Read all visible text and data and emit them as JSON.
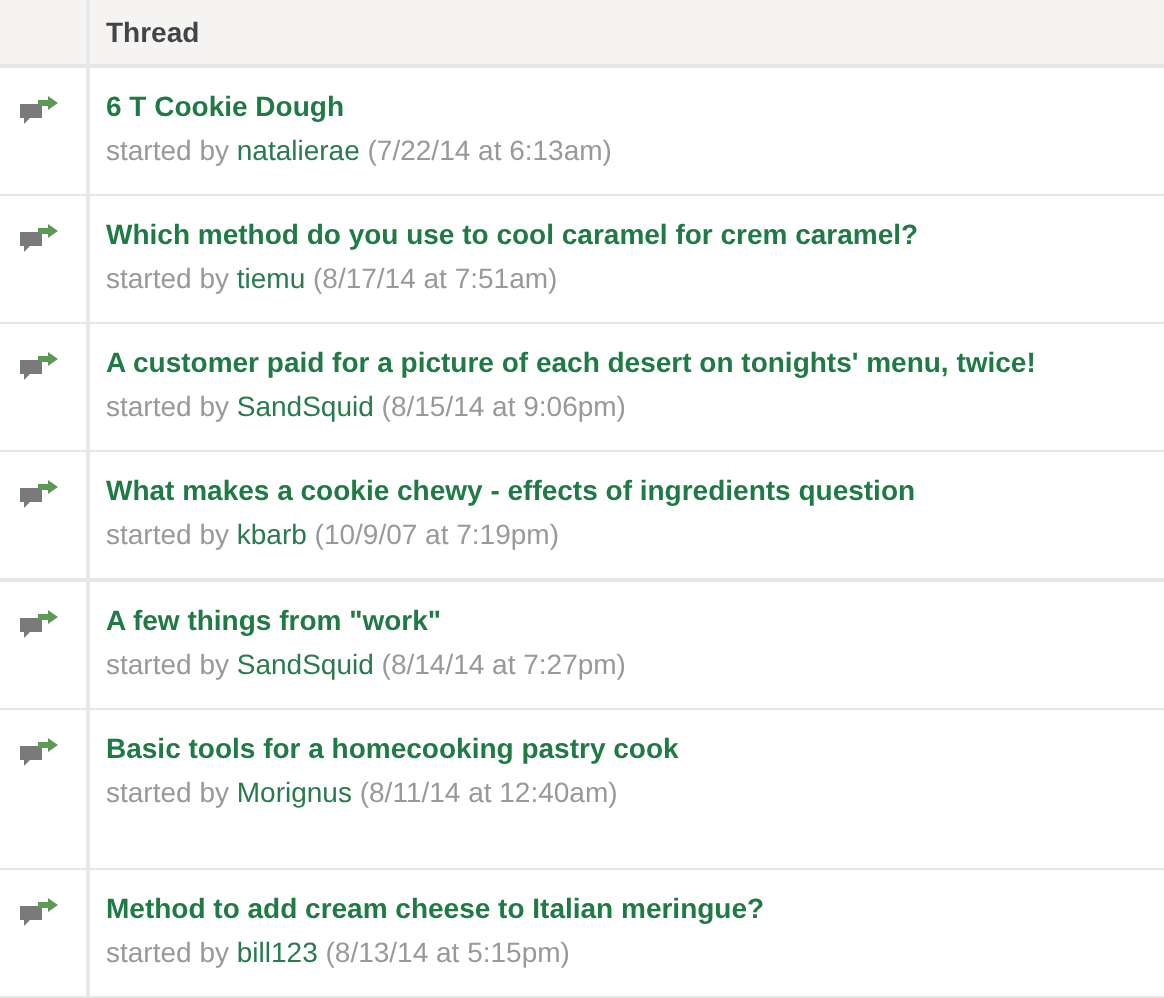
{
  "table": {
    "columns": [
      "Thread"
    ],
    "rows": [
      {
        "title": "6 T Cookie Dough",
        "prefix": "started by",
        "user": "natalierae",
        "date": "(7/22/14 at 6:13am)"
      },
      {
        "title": "Which method do you use to cool caramel for crem caramel?",
        "prefix": "started by",
        "user": "tiemu",
        "date": "(8/17/14 at 7:51am)"
      },
      {
        "title": "A customer paid for a picture of each desert on tonights' menu, twice!",
        "prefix": "started by",
        "user": "SandSquid",
        "date": "(8/15/14 at 9:06pm)"
      },
      {
        "title": "What makes a cookie chewy - effects of ingredients question",
        "prefix": "started by",
        "user": "kbarb",
        "date": "(10/9/07 at 7:19pm)"
      },
      {
        "title": "A few things from \"work\"",
        "prefix": "started by",
        "user": "SandSquid",
        "date": "(8/14/14 at 7:27pm)"
      },
      {
        "title": "Basic tools for a homecooking pastry cook",
        "prefix": "started by",
        "user": "Morignus",
        "date": "(8/11/14 at 12:40am)"
      },
      {
        "title": "Method to add cream cheese to Italian meringue?",
        "prefix": "started by",
        "user": "bill123",
        "date": "(8/13/14 at 5:15pm)"
      }
    ]
  }
}
